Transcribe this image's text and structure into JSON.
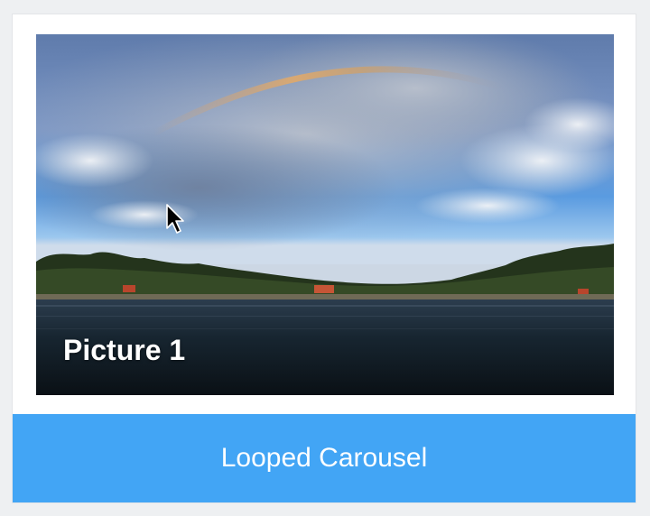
{
  "carousel": {
    "slides": [
      {
        "caption": "Picture 1",
        "image": "lake-with-rainbow-landscape"
      }
    ],
    "active_index": 0
  },
  "footer": {
    "title": "Looped Carousel"
  },
  "colors": {
    "footer_bg": "#42a5f5",
    "card_bg": "#ffffff",
    "page_bg": "#eef0f2"
  },
  "cursor": {
    "icon": "arrow-pointer-icon"
  }
}
